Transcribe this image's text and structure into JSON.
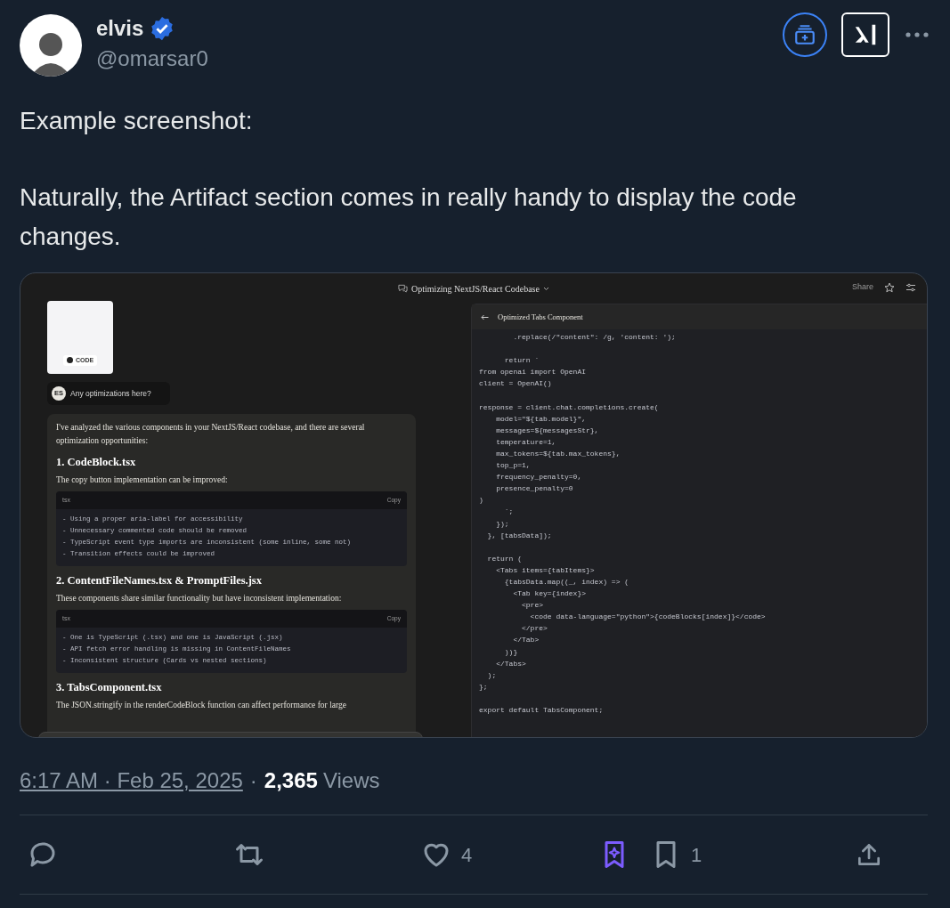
{
  "author": {
    "name": "elvis",
    "handle": "@omarsar0",
    "verified": true
  },
  "tweet_text": [
    "Example screenshot:",
    "Naturally, the Artifact section comes in really handy to display the code changes."
  ],
  "embedded_screenshot": {
    "chat_title": "Optimizing NextJS/React Codebase",
    "share": "Share",
    "attachment_label": "CODE",
    "user_initials": "ES",
    "user_message": "Any optimizations here?",
    "response_intro": "I've analyzed the various components in your NextJS/React codebase, and there are several optimization opportunities:",
    "sections": [
      {
        "heading": "1. CodeBlock.tsx",
        "text": "The copy button implementation can be improved:",
        "code": {
          "language": "tsx",
          "copy": "Copy",
          "lines": [
            "- Using a proper aria-label for accessibility",
            "- Unnecessary commented code should be removed",
            "- TypeScript event type imports are inconsistent (some inline, some not)",
            "- Transition effects could be improved"
          ]
        }
      },
      {
        "heading": "2. ContentFileNames.tsx & PromptFiles.jsx",
        "text": "These components share similar functionality but have inconsistent implementation:",
        "code": {
          "language": "tsx",
          "copy": "Copy",
          "lines": [
            "- One is TypeScript (.tsx) and one is JavaScript (.jsx)",
            "- API fetch error handling is missing in ContentFileNames",
            "- Inconsistent structure (Cards vs nested sections)"
          ]
        }
      },
      {
        "heading": "3. TabsComponent.tsx",
        "text": "The JSON.stringify in the renderCodeBlock function can affect performance for large"
      }
    ],
    "artifact_title": "Optimized Tabs Component",
    "artifact_code": "        .replace(/\"content\": /g, 'content: ');\n\n      return `\nfrom openai import OpenAI\nclient = OpenAI()\n\nresponse = client.chat.completions.create(\n    model=\"${tab.model}\",\n    messages=${messagesStr},\n    temperature=1,\n    max_tokens=${tab.max_tokens},\n    top_p=1,\n    frequency_penalty=0,\n    presence_penalty=0\n)\n      `;\n    });\n  }, [tabsData]);\n\n  return (\n    <Tabs items={tabItems}>\n      {tabsData.map((_, index) => (\n        <Tab key={index}>\n          <pre>\n            <code data-language=\"python\">{codeBlocks[index]}</code>\n          </pre>\n        </Tab>\n      ))}\n    </Tabs>\n  );\n};\n\nexport default TabsComponent;"
  },
  "timestamp": "6:17 AM · Feb 25, 2025",
  "separator": "·",
  "views_count": "2,365",
  "views_label": "Views",
  "actions": [
    {
      "kind": "reply"
    },
    {
      "kind": "repost"
    },
    {
      "kind": "like",
      "count": "4"
    },
    {
      "kind": "grok"
    },
    {
      "kind": "bookmark",
      "count": "1"
    },
    {
      "kind": "share"
    }
  ]
}
